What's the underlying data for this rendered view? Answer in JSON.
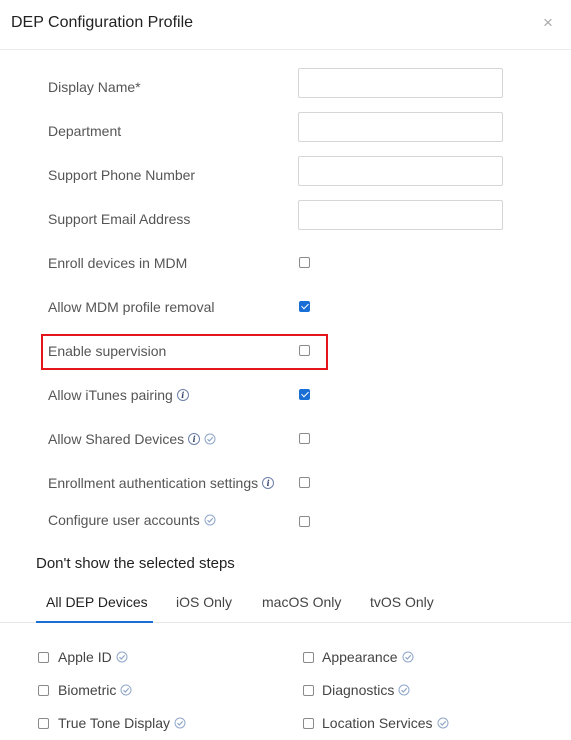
{
  "dialog": {
    "title": "DEP Configuration Profile",
    "close_glyph": "×"
  },
  "fields": {
    "display_name": {
      "label": "Display Name*",
      "value": "",
      "placeholder": ""
    },
    "department": {
      "label": "Department",
      "value": "",
      "placeholder": ""
    },
    "support_phone": {
      "label": "Support Phone Number",
      "value": "",
      "placeholder": ""
    },
    "support_email": {
      "label": "Support Email Address",
      "value": "",
      "placeholder": ""
    }
  },
  "options": {
    "enroll_devices": {
      "label": "Enroll devices in MDM",
      "checked": false
    },
    "allow_removal": {
      "label": "Allow MDM profile removal",
      "checked": true
    },
    "enable_supervision": {
      "label": "Enable supervision",
      "checked": false
    },
    "allow_itunes": {
      "label": "Allow iTunes pairing",
      "checked": true
    },
    "allow_shared": {
      "label": "Allow Shared Devices",
      "checked": false
    },
    "enrollment_auth": {
      "label": "Enrollment authentication settings",
      "checked": false
    },
    "configure_accounts": {
      "label": "Configure user accounts",
      "checked": false
    }
  },
  "steps_section": {
    "title": "Don't show the selected steps",
    "tabs": [
      "All DEP Devices",
      "iOS Only",
      "macOS Only",
      "tvOS Only"
    ],
    "active_tab": "All DEP Devices"
  },
  "steps": {
    "apple_id": {
      "label": "Apple ID",
      "checked": false
    },
    "appearance": {
      "label": "Appearance",
      "checked": false
    },
    "biometric": {
      "label": "Biometric",
      "checked": false
    },
    "diagnostics": {
      "label": "Diagnostics",
      "checked": false
    },
    "true_tone": {
      "label": "True Tone Display",
      "checked": false
    },
    "location": {
      "label": "Location Services",
      "checked": false
    }
  },
  "icons": {
    "info": "info-icon",
    "verified": "verified-check-icon",
    "close": "close-icon"
  },
  "colors": {
    "accent": "#1a6fd6",
    "highlight": "#e4161c"
  }
}
